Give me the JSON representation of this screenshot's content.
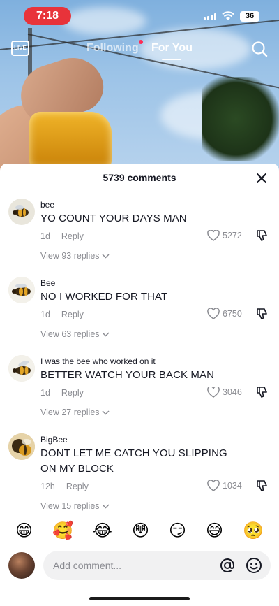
{
  "status_bar": {
    "time": "7:18",
    "battery": "36"
  },
  "top_nav": {
    "live_label": "LIVE",
    "tab_following": "Following",
    "tab_for_you": "For You"
  },
  "comments_header": {
    "count_label": "5739 comments"
  },
  "comments": [
    {
      "username": "bee",
      "text": "YO COUNT YOUR DAYS MAN",
      "age": "1d",
      "reply_label": "Reply",
      "likes": "5272",
      "view_replies": "View 93 replies"
    },
    {
      "username": "Bee",
      "text": "NO I WORKED FOR THAT",
      "age": "1d",
      "reply_label": "Reply",
      "likes": "6750",
      "view_replies": "View 63 replies"
    },
    {
      "username": "I was the bee who worked on it",
      "text": "BETTER WATCH YOUR BACK MAN",
      "age": "1d",
      "reply_label": "Reply",
      "likes": "3046",
      "view_replies": "View 27 replies"
    },
    {
      "username": "BigBee",
      "text": "DONT LET ME CATCH YOU SLIPPING ON MY BLOCK",
      "age": "12h",
      "reply_label": "Reply",
      "likes": "1034",
      "view_replies": "View 15 replies"
    }
  ],
  "emoji_bar": [
    "😁",
    "🥰",
    "😂",
    "😳",
    "😏",
    "😅",
    "🥺"
  ],
  "input": {
    "placeholder": "Add comment..."
  },
  "colors": {
    "accent": "#fe2c55",
    "time_pill": "#e8333a",
    "muted": "#8a8b91",
    "text": "#161823"
  }
}
